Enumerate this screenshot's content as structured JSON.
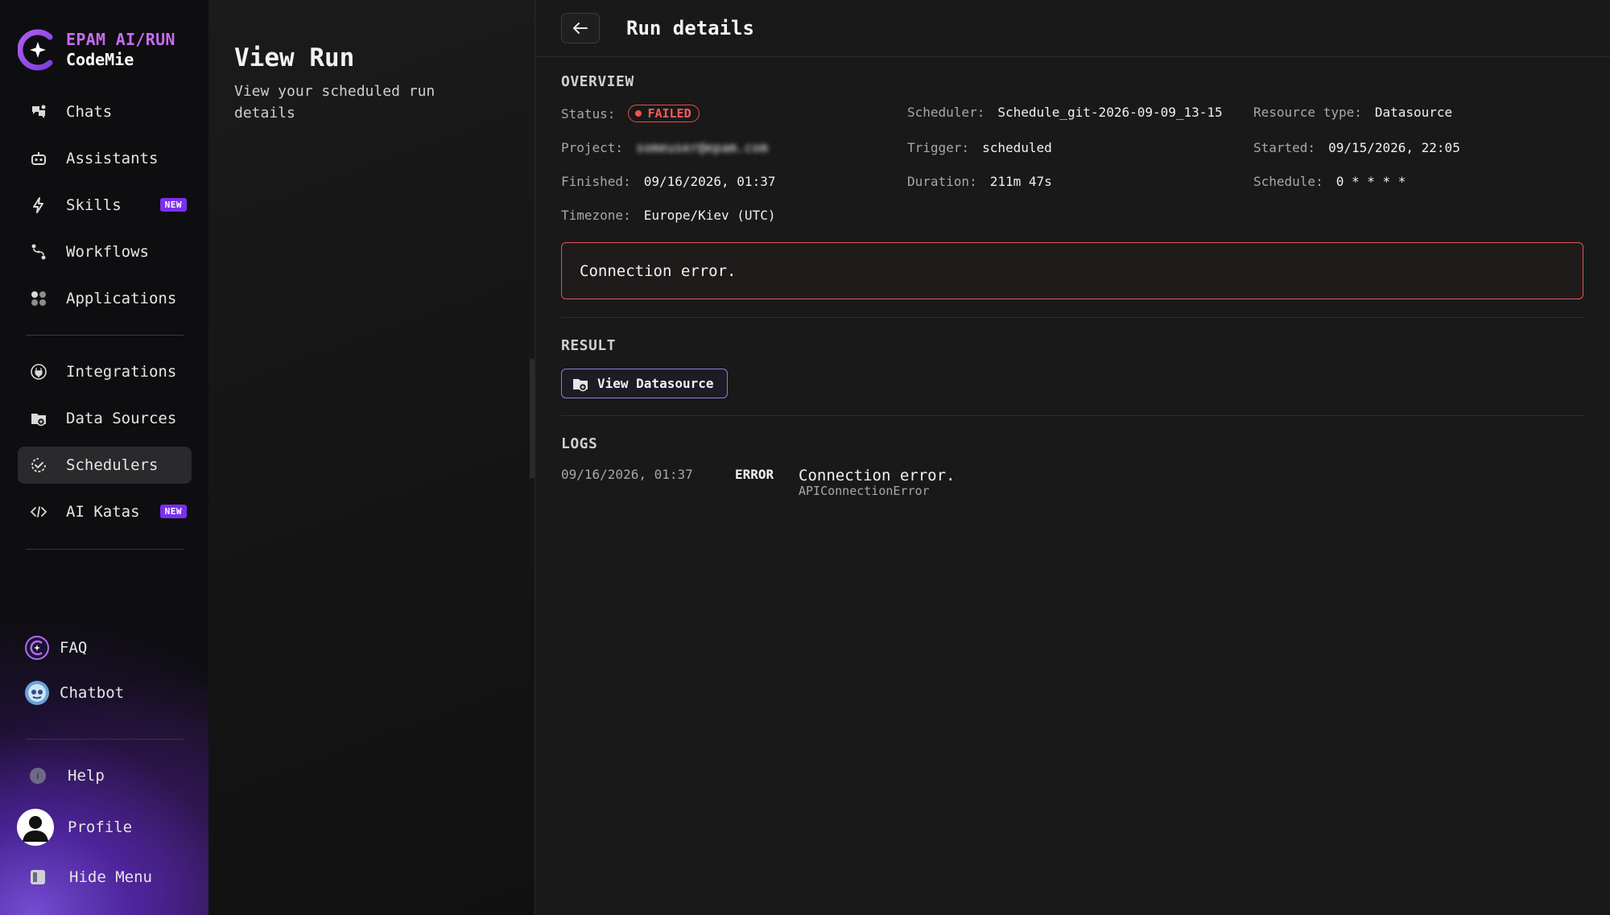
{
  "brand": {
    "line1": "EPAM AI/RUN",
    "line2": "CodeMie"
  },
  "nav": {
    "items": [
      {
        "label": "Chats",
        "icon": "chat-icon"
      },
      {
        "label": "Assistants",
        "icon": "robot-icon"
      },
      {
        "label": "Skills",
        "icon": "lightning-icon",
        "badge": "NEW"
      },
      {
        "label": "Workflows",
        "icon": "workflow-icon"
      },
      {
        "label": "Applications",
        "icon": "apps-icon"
      },
      {
        "label": "Integrations",
        "icon": "plug-icon"
      },
      {
        "label": "Data Sources",
        "icon": "datasource-icon"
      },
      {
        "label": "Schedulers",
        "icon": "scheduler-icon",
        "active": true
      },
      {
        "label": "AI Katas",
        "icon": "code-icon",
        "badge": "NEW"
      }
    ],
    "faq": "FAQ",
    "chatbot": "Chatbot",
    "help": "Help",
    "profile": "Profile",
    "hide_menu": "Hide Menu"
  },
  "middle": {
    "title": "View Run",
    "subtitle": "View your scheduled run details"
  },
  "header": {
    "title": "Run details"
  },
  "overview": {
    "heading": "OVERVIEW",
    "status_label": "Status:",
    "status_value": "FAILED",
    "scheduler_label": "Scheduler:",
    "scheduler_value": "Schedule_git-2026-09-09_13-15",
    "resource_type_label": "Resource type:",
    "resource_type_value": "Datasource",
    "project_label": "Project:",
    "project_value": "someuser@epam.com",
    "trigger_label": "Trigger:",
    "trigger_value": "scheduled",
    "started_label": "Started:",
    "started_value": "09/15/2026, 22:05",
    "finished_label": "Finished:",
    "finished_value": "09/16/2026, 01:37",
    "duration_label": "Duration:",
    "duration_value": "211m 47s",
    "schedule_label": "Schedule:",
    "schedule_value": "0 * * * *",
    "timezone_label": "Timezone:",
    "timezone_value": "Europe/Kiev (UTC)",
    "error_message": "Connection error."
  },
  "result": {
    "heading": "RESULT",
    "button_label": "View Datasource"
  },
  "logs": {
    "heading": "LOGS",
    "entries": [
      {
        "time": "09/16/2026, 01:37",
        "level": "ERROR",
        "message": "Connection error.",
        "type": "APIConnectionError"
      }
    ]
  },
  "colors": {
    "accent": "#c86bf2",
    "badge": "#7b2ff0",
    "error": "#ff5a5a",
    "button_border": "#8a7be0"
  }
}
